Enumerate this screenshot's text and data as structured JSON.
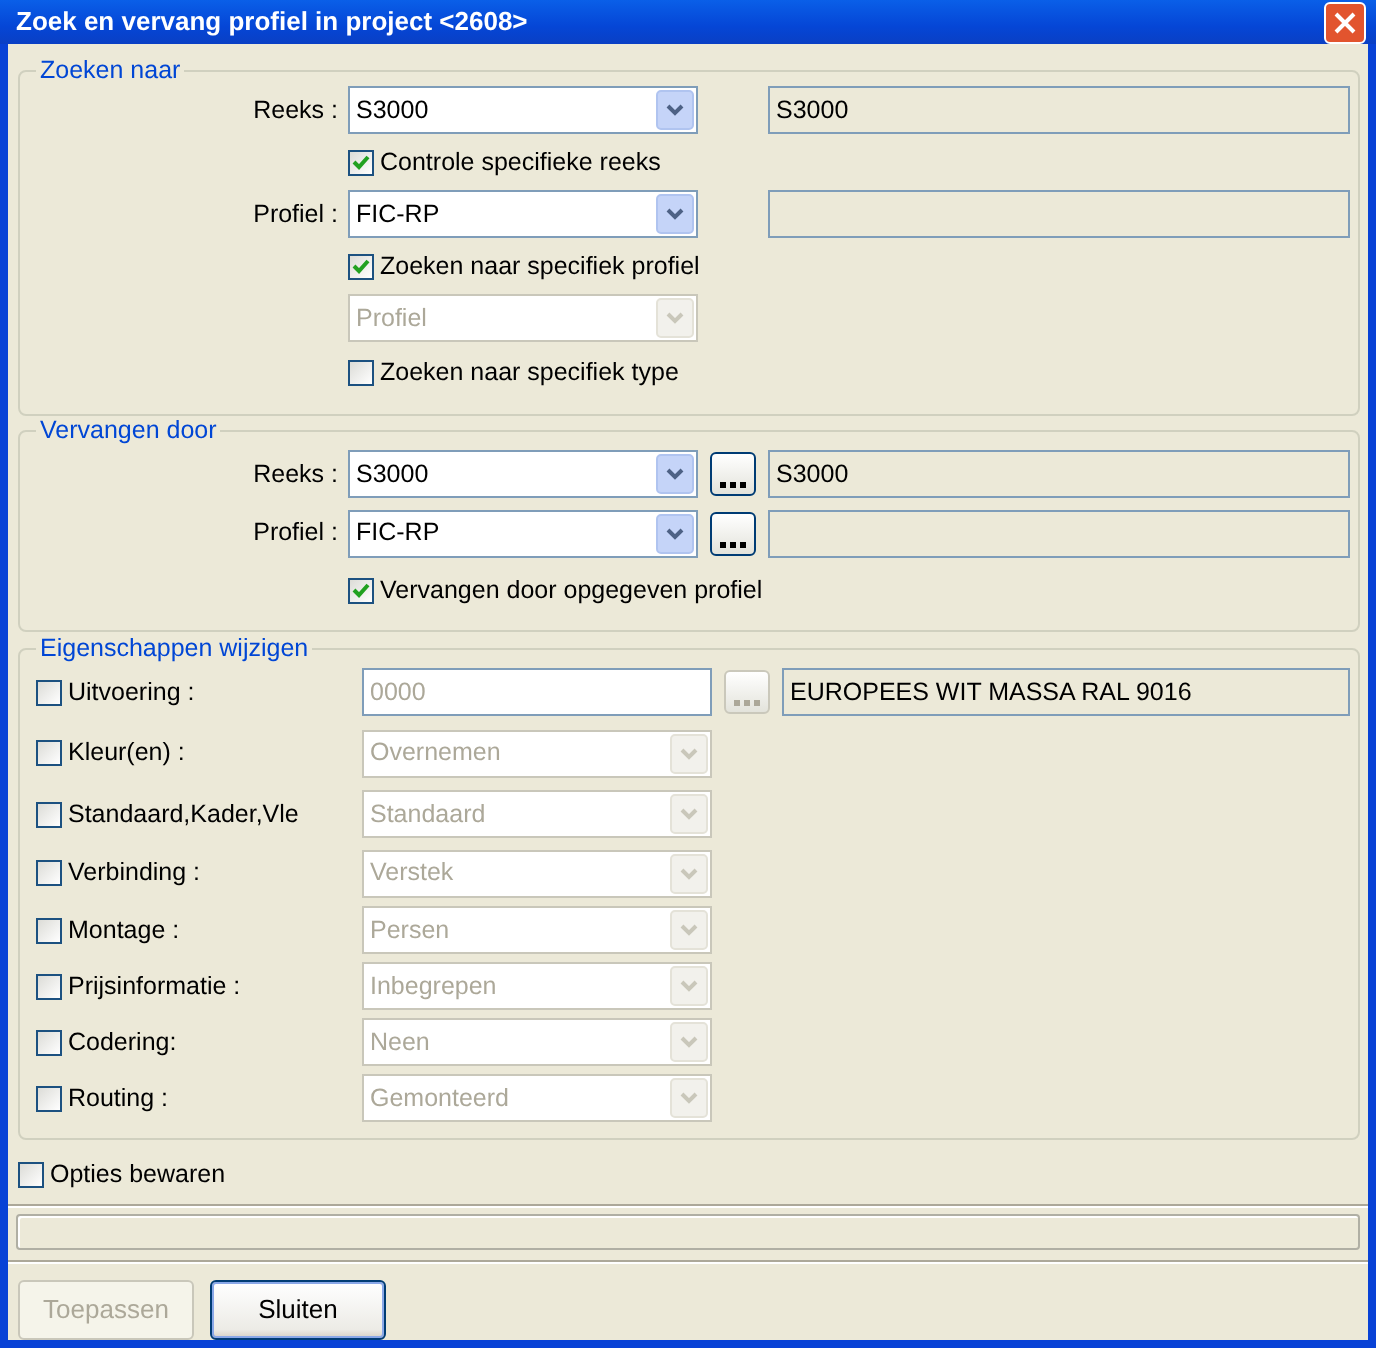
{
  "window": {
    "title": "Zoek en vervang profiel in project <2608>"
  },
  "groups": [
    {
      "title": "Zoeken naar",
      "rows": [
        {
          "kind": "combo",
          "label": "Reeks :",
          "value": "S3000",
          "disabled": false,
          "browse": false,
          "info_box": true,
          "info": "S3000"
        },
        {
          "kind": "check",
          "label": "Controle specifieke reeks",
          "checked": true
        },
        {
          "kind": "combo",
          "label": "Profiel :",
          "value": "FIC-RP",
          "disabled": false,
          "browse": false,
          "info_box": true
        },
        {
          "kind": "check",
          "label": "Zoeken naar specifiek profiel",
          "checked": true
        },
        {
          "kind": "combo",
          "value": "Profiel",
          "disabled": true,
          "browse": false,
          "info_box": false
        },
        {
          "kind": "check",
          "label": "Zoeken naar specifiek type",
          "checked": false
        }
      ]
    },
    {
      "title": "Vervangen door",
      "rows": [
        {
          "kind": "combo",
          "label": "Reeks :",
          "value": "S3000",
          "disabled": false,
          "browse": true,
          "info_box": true,
          "info": "S3000"
        },
        {
          "kind": "combo",
          "label": "Profiel :",
          "value": "FIC-RP",
          "disabled": false,
          "browse": true,
          "info_box": true
        },
        {
          "kind": "check",
          "label": "Vervangen door opgegeven profiel",
          "checked": true
        }
      ]
    },
    {
      "title": "Eigenschappen wijzigen",
      "rows": [
        {
          "kind": "text_prop",
          "label": "Uitvoering :",
          "checked": false,
          "value": "0000",
          "disabled": true,
          "browse": true,
          "info_box": true,
          "info": "EUROPEES WIT MASSA RAL 9016"
        },
        {
          "kind": "combo_prop",
          "label": "Kleur(en) :",
          "checked": false,
          "value": "Overnemen",
          "disabled": true
        },
        {
          "kind": "combo_prop",
          "label": "Standaard,Kader,Vle",
          "checked": false,
          "value": "Standaard",
          "disabled": true
        },
        {
          "kind": "combo_prop",
          "label": "Verbinding :",
          "checked": false,
          "value": "Verstek",
          "disabled": true
        },
        {
          "kind": "combo_prop",
          "label": "Montage :",
          "checked": false,
          "value": "Persen",
          "disabled": true
        },
        {
          "kind": "combo_prop",
          "label": "Prijsinformatie :",
          "checked": false,
          "value": "Inbegrepen",
          "disabled": true
        },
        {
          "kind": "combo_prop",
          "label": "Codering:",
          "checked": false,
          "value": "Neen",
          "disabled": true
        },
        {
          "kind": "combo_prop",
          "label": "Routing :",
          "checked": false,
          "value": "Gemonteerd",
          "disabled": true
        }
      ]
    }
  ],
  "save_options": {
    "label": "Opties bewaren",
    "checked": false
  },
  "progress": {
    "level": 0
  },
  "buttons": [
    {
      "label": "Toepassen",
      "disabled": true,
      "default": false
    },
    {
      "label": "Sluiten",
      "disabled": false,
      "default": true
    }
  ]
}
